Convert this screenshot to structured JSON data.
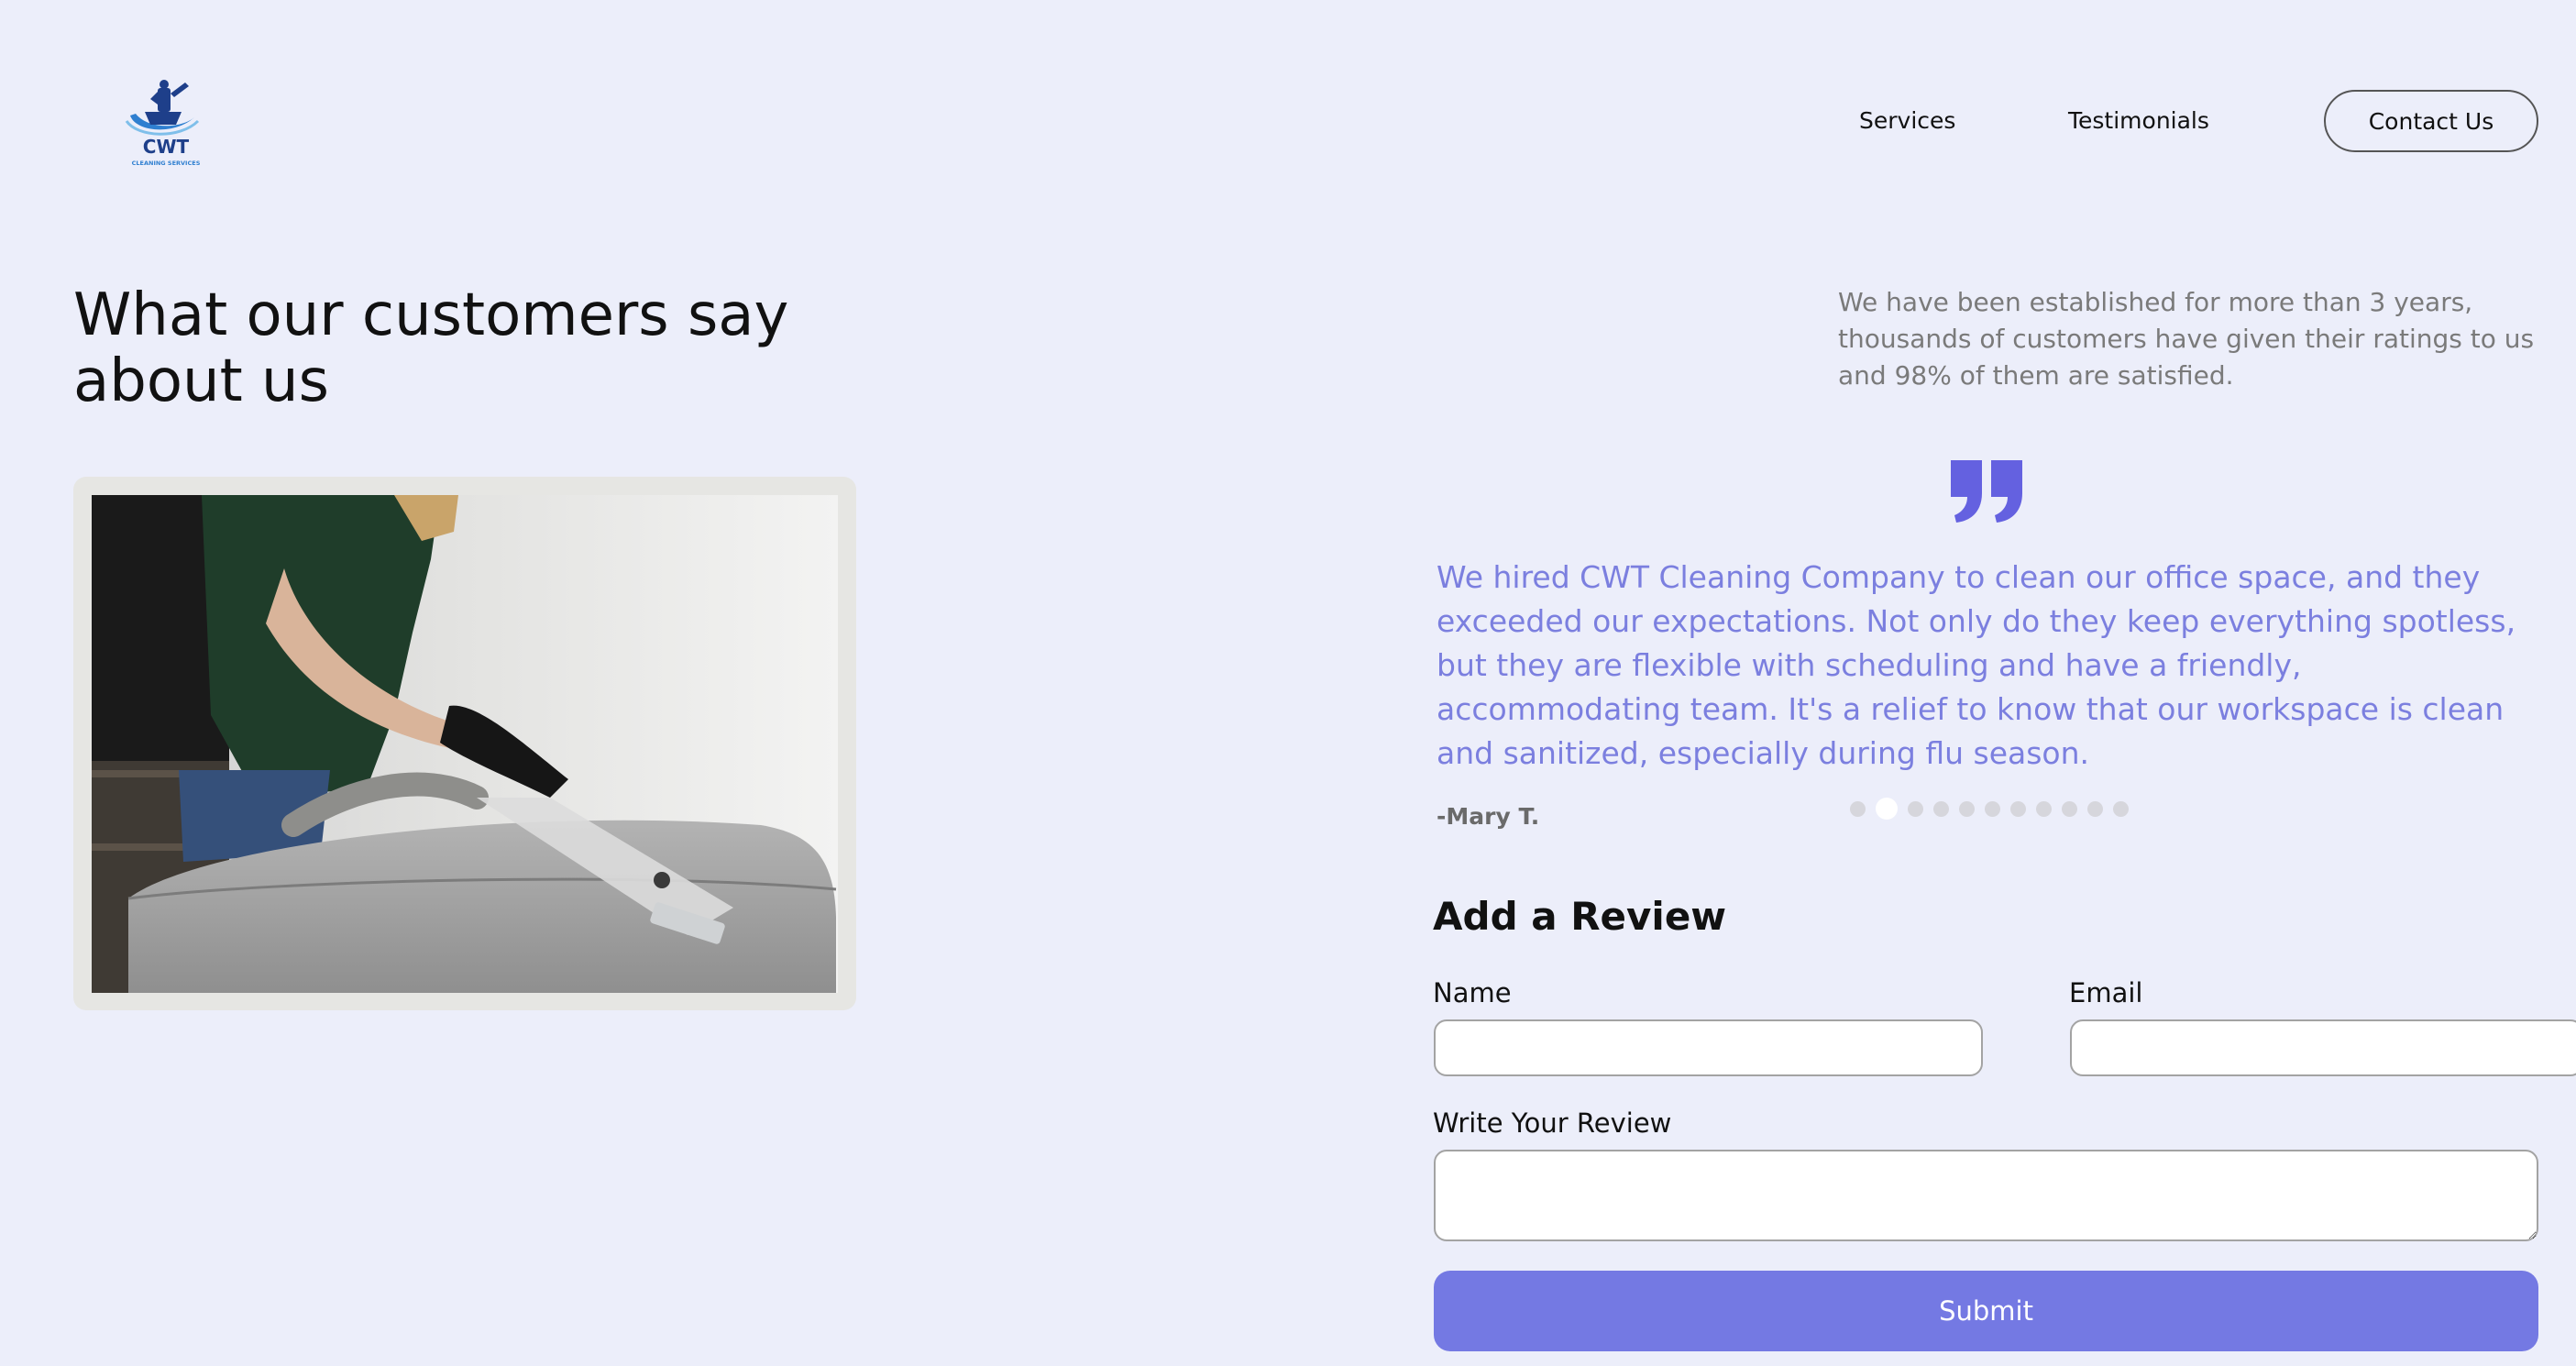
{
  "header": {
    "logo": {
      "title": "CWT",
      "subtitle": "CLEANING SERVICES"
    },
    "nav": {
      "services": "Services",
      "testimonials": "Testimonials",
      "contact": "Contact Us"
    }
  },
  "testimonials_section": {
    "title": "What our customers say about us",
    "intro": "We have been established for more than 3 years, thousands of customers have given their ratings to us and 98% of them are satisfied.",
    "quote": "We hired CWT Cleaning Company to clean our office space, and they exceeded our expectations. Not only do they keep everything spotless, but they are flexible with scheduling and have a friendly, accommodating team. It's a relief to know that our workspace is clean and sanitized, especially during flu season.",
    "author": "-Mary T.",
    "carousel": {
      "count": 11,
      "active_index": 1
    }
  },
  "review_form": {
    "title": "Add a Review",
    "name_label": "Name",
    "name_value": "",
    "email_label": "Email",
    "email_value": "",
    "review_label": "Write Your Review",
    "review_value": "",
    "submit_label": "Submit"
  },
  "colors": {
    "page_background": "#eceefa",
    "accent": "#6461e0",
    "quote_text": "#7b7fdf",
    "submit_button": "#7479e3",
    "logo_blue": "#1e3f8a"
  },
  "icons": {
    "logo": "cleaning-boat-logo-icon",
    "quote": "closing-quote-icon"
  }
}
